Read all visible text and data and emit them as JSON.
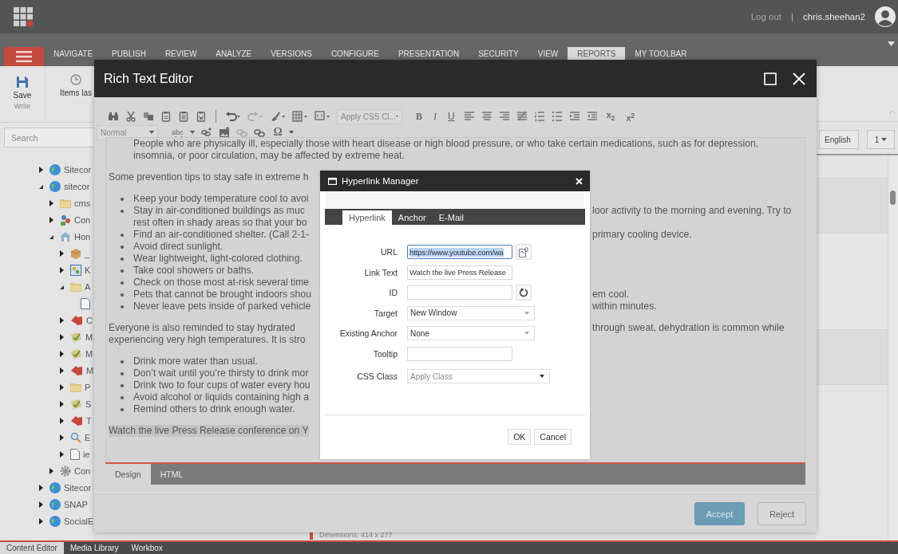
{
  "header": {
    "logout": "Log out",
    "separator": "|",
    "user": "chris.sheehan2"
  },
  "ribbon_tabs": [
    {
      "label": "NAVIGATE",
      "selected": false
    },
    {
      "label": "PUBLISH",
      "selected": false
    },
    {
      "label": "REVIEW",
      "selected": false
    },
    {
      "label": "ANALYZE",
      "selected": false
    },
    {
      "label": "VERSIONS",
      "selected": false
    },
    {
      "label": "CONFIGURE",
      "selected": false
    },
    {
      "label": "PRESENTATION",
      "selected": false
    },
    {
      "label": "SECURITY",
      "selected": false
    },
    {
      "label": "VIEW",
      "selected": false
    },
    {
      "label": "REPORTS",
      "selected": true
    },
    {
      "label": "MY TOOLBAR",
      "selected": false
    }
  ],
  "ribbon": {
    "save": "Save",
    "group": "Write",
    "items_last": "Items las"
  },
  "search": {
    "placeholder": "Search"
  },
  "tree": {
    "items": [
      {
        "label": "Sitecor",
        "kind": "globe",
        "expanded": false,
        "selected": false
      },
      {
        "label": "sitecor",
        "kind": "globe",
        "expanded": true,
        "selected": false,
        "children": [
          {
            "label": "cms",
            "kind": "folder",
            "expanded": false,
            "selected": false
          },
          {
            "label": "Con",
            "kind": "people",
            "expanded": false,
            "selected": false
          },
          {
            "label": "Hon",
            "kind": "home",
            "expanded": true,
            "selected": false,
            "children": [
              {
                "label": "_",
                "kind": "box",
                "expanded": false,
                "selected": false
              },
              {
                "label": "K",
                "kind": "picture",
                "expanded": false,
                "selected": false
              },
              {
                "label": "A",
                "kind": "folder",
                "expanded": true,
                "selected": false,
                "children": [
                  {
                    "kind": "page",
                    "selected": true
                  }
                ]
              },
              {
                "label": "C",
                "kind": "flag",
                "expanded": false,
                "selected": false
              },
              {
                "label": "M",
                "kind": "check",
                "expanded": false,
                "selected": false
              },
              {
                "label": "M",
                "kind": "check",
                "expanded": false,
                "selected": false
              },
              {
                "label": "M",
                "kind": "flag",
                "expanded": false,
                "selected": false
              },
              {
                "label": "P",
                "kind": "folder",
                "expanded": false,
                "selected": false
              },
              {
                "label": "S",
                "kind": "check",
                "expanded": false,
                "selected": false
              },
              {
                "label": "T",
                "kind": "flag",
                "expanded": false,
                "selected": false
              },
              {
                "label": "E",
                "kind": "search",
                "expanded": false,
                "selected": false
              },
              {
                "label": "ie",
                "kind": "page",
                "expanded": false,
                "selected": false
              }
            ]
          },
          {
            "label": "Con",
            "kind": "gear",
            "expanded": false,
            "selected": false
          }
        ]
      },
      {
        "label": "Sitecor",
        "kind": "globe",
        "expanded": false,
        "selected": false
      },
      {
        "label": "SNAP",
        "kind": "globe",
        "expanded": false,
        "selected": false
      },
      {
        "label": "SocialE",
        "kind": "globe",
        "expanded": false,
        "selected": false
      }
    ]
  },
  "right_panel": {
    "language": "English",
    "version": "1"
  },
  "dimensions": "Dimensions: 414 x 277",
  "bottom_tabs": [
    {
      "label": "Content Editor",
      "selected": true
    },
    {
      "label": "Media Library",
      "selected": false
    },
    {
      "label": "Workbox",
      "selected": false
    }
  ],
  "editor": {
    "title": "Rich Text Editor",
    "css_dropdown": "Apply CSS Cl...",
    "bold": "B",
    "italic": "I",
    "underline": "U",
    "subscript": "x$_{2}$",
    "superscript": "x$^{2}$",
    "paragraph_style": "Normal",
    "spellcheck": "abc",
    "symbol": "Ω",
    "blocks": [
      {
        "highlighted": false,
        "rows": [
          {
            "kind": "cont",
            "left": "People who are physically ill, especially those with heart disease or high blood pressure, or who take certain medications, such as for depression,"
          },
          {
            "kind": "cont",
            "left": "insomnia, or poor circulation, may be affected by extreme heat."
          }
        ]
      },
      {
        "highlighted": false,
        "rows": [
          {
            "kind": "text",
            "left": "Some prevention tips to stay safe in extreme h"
          }
        ]
      },
      {
        "highlighted": false,
        "rows": [
          {
            "kind": "bullet",
            "left": "Keep your body temperature cool to avoi"
          },
          {
            "kind": "bullet",
            "left": "Stay in air-conditioned buildings as muc",
            "right": "loor activity to the morning and evening. Try to"
          },
          {
            "kind": "cont",
            "left": "rest often in shady areas so that your bo"
          },
          {
            "kind": "bullet",
            "left": "Find an air-conditioned shelter. (Call 2-1-",
            "right": "primary cooling device."
          },
          {
            "kind": "bullet",
            "left": "Avoid direct sunlight."
          },
          {
            "kind": "bullet",
            "left": "Wear lightweight, light-colored clothing."
          },
          {
            "kind": "bullet",
            "left": "Take cool showers or baths."
          },
          {
            "kind": "bullet",
            "left": "Check on those most at-risk several time"
          },
          {
            "kind": "bullet",
            "left": "Pets that cannot be brought indoors shou",
            "right": "em cool."
          },
          {
            "kind": "bullet",
            "left": "Never leave pets inside of parked vehicle",
            "right": "within minutes."
          }
        ]
      },
      {
        "highlighted": false,
        "rows": [
          {
            "kind": "text",
            "left": "Everyone is also reminded to stay hydrated",
            "right": "through sweat, dehydration is common while"
          },
          {
            "kind": "text",
            "left": "experiencing very high temperatures. It is stro"
          }
        ]
      },
      {
        "highlighted": false,
        "rows": [
          {
            "kind": "bullet",
            "left": "Drink more water than usual."
          },
          {
            "kind": "bullet",
            "left": "Don’t wait until you’re thirsty to drink mor"
          },
          {
            "kind": "bullet",
            "left": "Drink two to four cups of water every hou"
          },
          {
            "kind": "bullet",
            "left": "Avoid alcohol or liquids containing high a"
          },
          {
            "kind": "bullet",
            "left": "Remind others to drink enough water."
          }
        ]
      },
      {
        "highlighted": true,
        "rows": [
          {
            "kind": "text",
            "left": "Watch the live Press Release conference on Y"
          }
        ]
      }
    ],
    "mode_tabs": [
      {
        "label": "Design",
        "selected": true
      },
      {
        "label": "HTML",
        "selected": false
      }
    ],
    "accept": "Accept",
    "reject": "Reject"
  },
  "hyperlink_manager": {
    "title": "Hyperlink Manager",
    "tabs": [
      {
        "label": "Hyperlink",
        "selected": true
      },
      {
        "label": "Anchor",
        "selected": false
      },
      {
        "label": "E-Mail",
        "selected": false
      }
    ],
    "fields": [
      {
        "label": "URL",
        "kind": "input-browse",
        "value": "https://www.youtube.com/wa",
        "focused": true
      },
      {
        "label": "Link Text",
        "kind": "input",
        "value": "Watch the live Press Release",
        "focused": false
      },
      {
        "label": "ID",
        "kind": "input-refresh",
        "focused": false
      },
      {
        "label": "Target",
        "kind": "select",
        "value": "New Window"
      },
      {
        "label": "Existing Anchor",
        "kind": "select",
        "value": "None"
      },
      {
        "label": "Tooltip",
        "kind": "input",
        "focused": false
      },
      {
        "label": "CSS Class",
        "kind": "class-select",
        "placeholder": "Apply Class"
      }
    ],
    "ok": "OK",
    "cancel": "Cancel"
  }
}
